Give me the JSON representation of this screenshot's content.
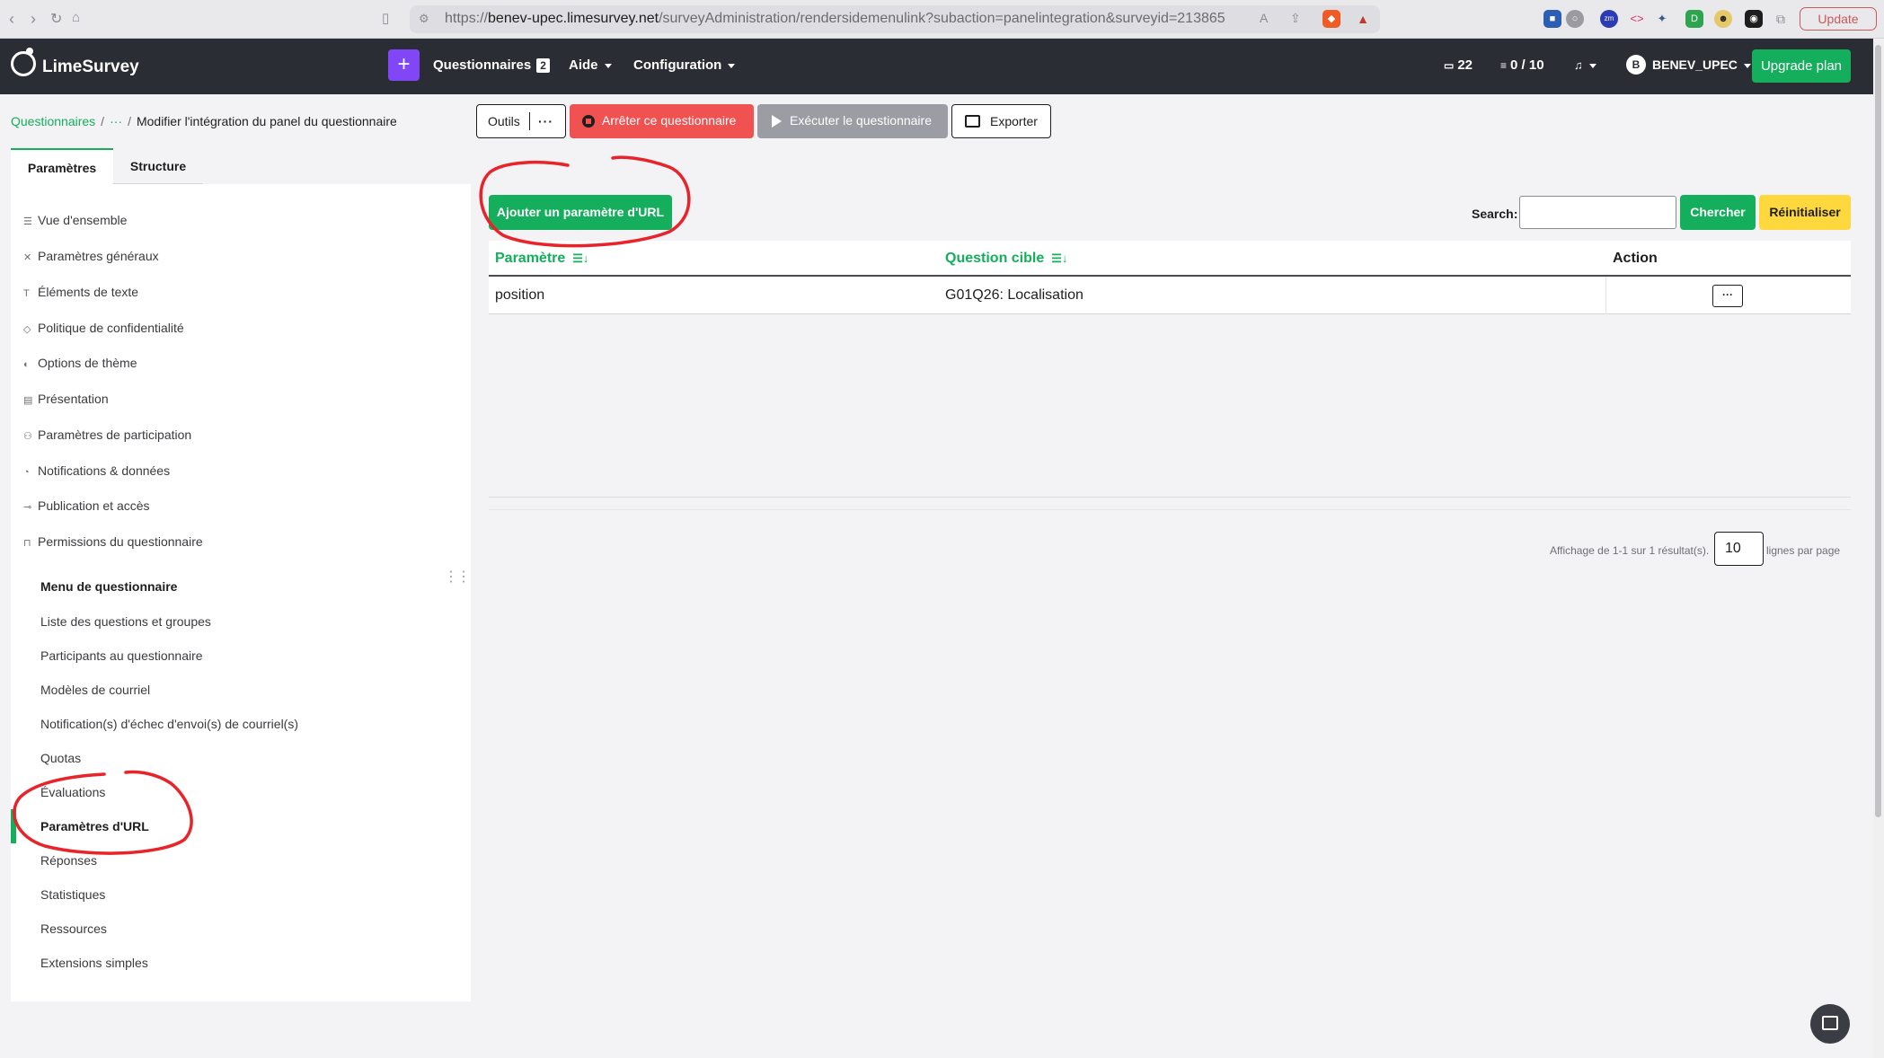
{
  "browser": {
    "url_prefix": "https://",
    "url_domain": "benev-upec.limesurvey.net",
    "url_path": "/surveyAdministration/rendersidemenulink?subaction=panelintegration&surveyid=213865",
    "update_label": "Update"
  },
  "topbar": {
    "brand": "LimeSurvey",
    "plus_label": "+",
    "questionnaires_label": "Questionnaires",
    "questionnaires_count": "2",
    "aide_label": "Aide",
    "configuration_label": "Configuration",
    "messages_count": "22",
    "storage_label": "0 / 10",
    "avatar_letter": "B",
    "user_label": "BENEV_UPEC",
    "upgrade_label": "Upgrade plan"
  },
  "breadcrumb": {
    "root": "Questionnaires",
    "ellipsis": "···",
    "current": "Modifier l'intégration du panel du questionnaire"
  },
  "sidebar": {
    "tabs": [
      {
        "label": "Paramètres"
      },
      {
        "label": "Structure"
      }
    ],
    "settings_items": [
      {
        "label": "Vue d'ensemble",
        "icon": "list-icon"
      },
      {
        "label": "Paramètres généraux",
        "icon": "tools-icon"
      },
      {
        "label": "Éléments de texte",
        "icon": "text-icon"
      },
      {
        "label": "Politique de confidentialité",
        "icon": "shield-icon"
      },
      {
        "label": "Options de thème",
        "icon": "palette-icon"
      },
      {
        "label": "Présentation",
        "icon": "layout-icon"
      },
      {
        "label": "Paramètres de participation",
        "icon": "participants-icon"
      },
      {
        "label": "Notifications & données",
        "icon": "bell-icon"
      },
      {
        "label": "Publication et accès",
        "icon": "key-icon"
      },
      {
        "label": "Permissions du questionnaire",
        "icon": "lock-icon"
      }
    ],
    "menu_heading": "Menu de questionnaire",
    "menu_items": [
      {
        "label": "Liste des questions et groupes"
      },
      {
        "label": "Participants au questionnaire"
      },
      {
        "label": "Modèles de courriel"
      },
      {
        "label": "Notification(s) d'échec d'envoi(s) de courriel(s)"
      },
      {
        "label": "Quotas"
      },
      {
        "label": "Évaluations"
      },
      {
        "label": "Paramètres d'URL"
      },
      {
        "label": "Réponses"
      },
      {
        "label": "Statistiques"
      },
      {
        "label": "Ressources"
      },
      {
        "label": "Extensions simples"
      }
    ]
  },
  "toolbar": {
    "outils_label": "Outils",
    "outils_dots": "···",
    "stop_label": "Arrêter ce questionnaire",
    "run_label": "Exécuter le questionnaire",
    "export_label": "Exporter"
  },
  "main": {
    "add_param_label": "Ajouter un paramètre d'URL",
    "search_label": "Search:",
    "search_value": "",
    "chercher_label": "Chercher",
    "reset_label": "Réinitialiser",
    "columns": [
      "Paramètre",
      "Question cible",
      "Action"
    ],
    "rows": [
      {
        "parametre": "position",
        "question": "G01Q26: Localisation",
        "action": "···"
      }
    ],
    "pager_summary": "Affichage de 1-1 sur 1 résultat(s).",
    "page_size": "10",
    "page_size_suffix": "lignes par page"
  },
  "colors": {
    "accent_green": "#14ae5c",
    "danger_red": "#f05252",
    "warning_yellow": "#ffd83d",
    "navbar_dark": "#2a2d33",
    "purple": "#8146f6",
    "annotation_red": "#e8232a"
  }
}
